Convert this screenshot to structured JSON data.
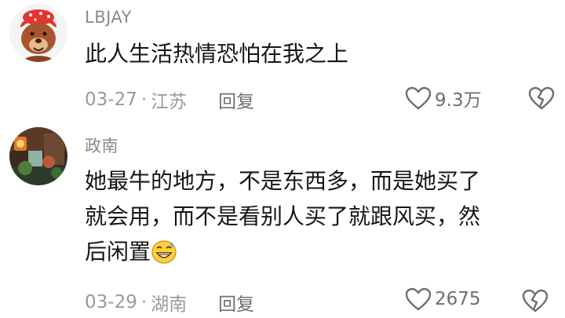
{
  "comments": [
    {
      "username": "LBJAY",
      "text": "此人生活热情恐怕在我之上",
      "date": "03-27",
      "separator": "·",
      "location": "江苏",
      "reply_label": "回复",
      "likes": "9.3万",
      "avatar_icon": "bear-avatar-icon"
    },
    {
      "username": "政南",
      "text_lines": [
        "她最牛的地方，不是东西多，而是她买了",
        "就会用，而不是看别人买了就跟风买，然",
        "后闲置"
      ],
      "emoji_icon": "sweat-smile-emoji-icon",
      "date": "03-29",
      "separator": "·",
      "location": "湖南",
      "reply_label": "回复",
      "likes": "2675",
      "avatar_icon": "room-photo-avatar-icon"
    }
  ],
  "colors": {
    "username": "#8a8a8a",
    "text": "#161616",
    "meta": "#9a9a9a",
    "icon": "#6f6f6f"
  }
}
